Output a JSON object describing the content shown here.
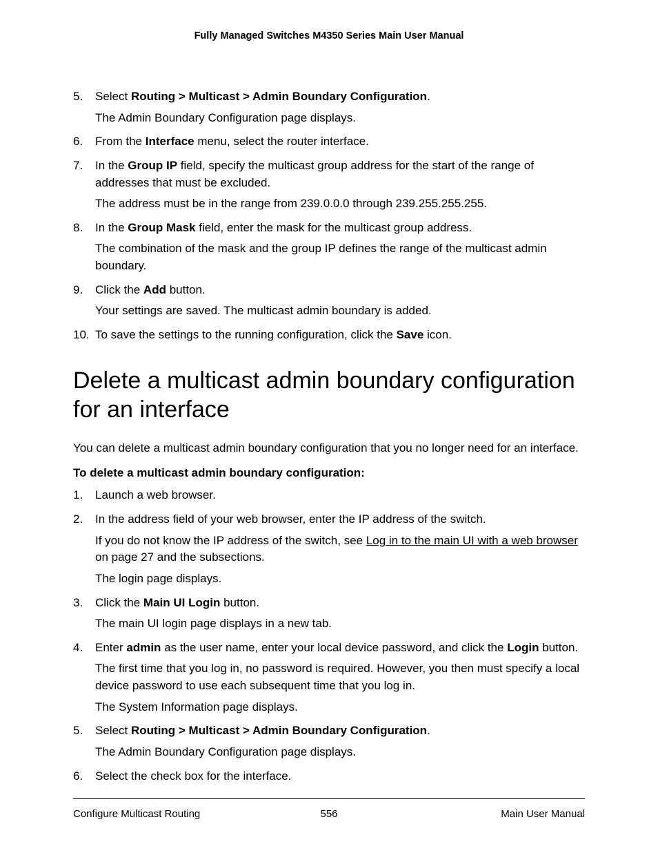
{
  "header": "Fully Managed Switches M4350 Series Main User Manual",
  "stepsA": {
    "s5": {
      "n": "5.",
      "lead": "Select ",
      "bold": "Routing > Multicast > Admin Boundary Configuration",
      "tail": ".",
      "p2": "The Admin Boundary Configuration page displays."
    },
    "s6": {
      "n": "6.",
      "lead": "From the ",
      "bold": "Interface",
      "tail": " menu, select the router interface."
    },
    "s7": {
      "n": "7.",
      "lead": "In the ",
      "bold": "Group IP",
      "tail": " field, specify the multicast group address for the start of the range of addresses that must be excluded.",
      "p2": "The address must be in the range from 239.0.0.0 through 239.255.255.255."
    },
    "s8": {
      "n": "8.",
      "lead": "In the ",
      "bold": "Group Mask",
      "tail": " field, enter the mask for the multicast group address.",
      "p2": "The combination of the mask and the group IP defines the range of the multicast admin boundary."
    },
    "s9": {
      "n": "9.",
      "lead": "Click the ",
      "bold": "Add",
      "tail": " button.",
      "p2": "Your settings are saved. The multicast admin boundary is added."
    },
    "s10": {
      "n": "10.",
      "lead": "To save the settings to the running configuration, click the ",
      "bold": "Save",
      "tail": " icon."
    }
  },
  "sectionTitle": "Delete a multicast admin boundary configuration for an interface",
  "intro": "You can delete a multicast admin boundary configuration that you no longer need for an interface.",
  "subhead": "To delete a multicast admin boundary configuration:",
  "stepsB": {
    "s1": {
      "n": "1.",
      "text": "Launch a web browser."
    },
    "s2": {
      "n": "2.",
      "text": "In the address field of your web browser, enter the IP address of the switch.",
      "p2a": "If you do not know the IP address of the switch, see ",
      "link": "Log in to the main UI with a web browser",
      "p2b": " on page 27 and the subsections.",
      "p3": "The login page displays."
    },
    "s3": {
      "n": "3.",
      "lead": "Click the ",
      "bold": "Main UI Login",
      "tail": " button.",
      "p2": "The main UI login page displays in a new tab."
    },
    "s4": {
      "n": "4.",
      "a": "Enter ",
      "b": "admin",
      "c": " as the user name, enter your local device password, and click the ",
      "d": "Login",
      "e": " button.",
      "p2": "The first time that you log in, no password is required. However, you then must specify a local device password to use each subsequent time that you log in.",
      "p3": "The System Information page displays."
    },
    "s5": {
      "n": "5.",
      "lead": "Select ",
      "bold": "Routing > Multicast > Admin Boundary Configuration",
      "tail": ".",
      "p2": "The Admin Boundary Configuration page displays."
    },
    "s6": {
      "n": "6.",
      "text": "Select the check box for the interface."
    }
  },
  "footer": {
    "left": "Configure Multicast Routing",
    "center": "556",
    "right": "Main User Manual"
  }
}
